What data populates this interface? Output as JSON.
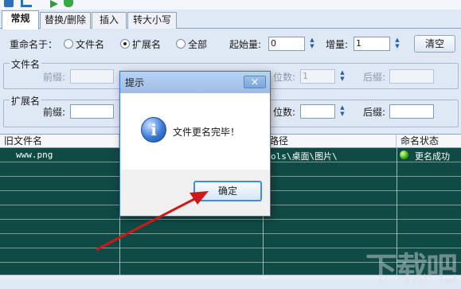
{
  "tabs": [
    {
      "label": "常规"
    },
    {
      "label": "替换/删除"
    },
    {
      "label": "插入"
    },
    {
      "label": "转大小写"
    }
  ],
  "rename": {
    "label": "重命名于：",
    "options": [
      {
        "label": "文件名",
        "selected": false
      },
      {
        "label": "扩展名",
        "selected": true
      },
      {
        "label": "全部",
        "selected": false
      }
    ],
    "start_label": "起始量:",
    "start_value": "0",
    "step_label": "增量:",
    "step_value": "1",
    "clear_label": "清空"
  },
  "filename_group": {
    "title": "文件名",
    "prefix_label": "前缀:",
    "digits_label": "位数:",
    "digits_value": "1",
    "suffix_label": "后缀:"
  },
  "ext_group": {
    "title": "扩展名",
    "prefix_label": "前缀:",
    "digits_label": "位数:",
    "suffix_label": "后缀:"
  },
  "table": {
    "columns": [
      "旧文件名",
      "路径",
      "命名状态"
    ],
    "rows": [
      {
        "old_name": "www.png",
        "path": "ols\\桌面\\图片\\",
        "status": "更名成功"
      }
    ]
  },
  "dialog": {
    "title": "提示",
    "message": "文件更名完毕！",
    "ok_label": "确定",
    "close_glyph": "×"
  },
  "icons": {
    "toolbar": [
      "save-icon",
      "undo-icon",
      "play-icon",
      "recycle-icon"
    ],
    "info": "info-icon",
    "status_ok": "green-circle-icon"
  },
  "colors": {
    "grid_bg": "#0f4a45",
    "arrow": "#d01818",
    "dialog_border": "#3d78c4",
    "status_ok": "#38b000"
  },
  "watermark": "下载吧"
}
